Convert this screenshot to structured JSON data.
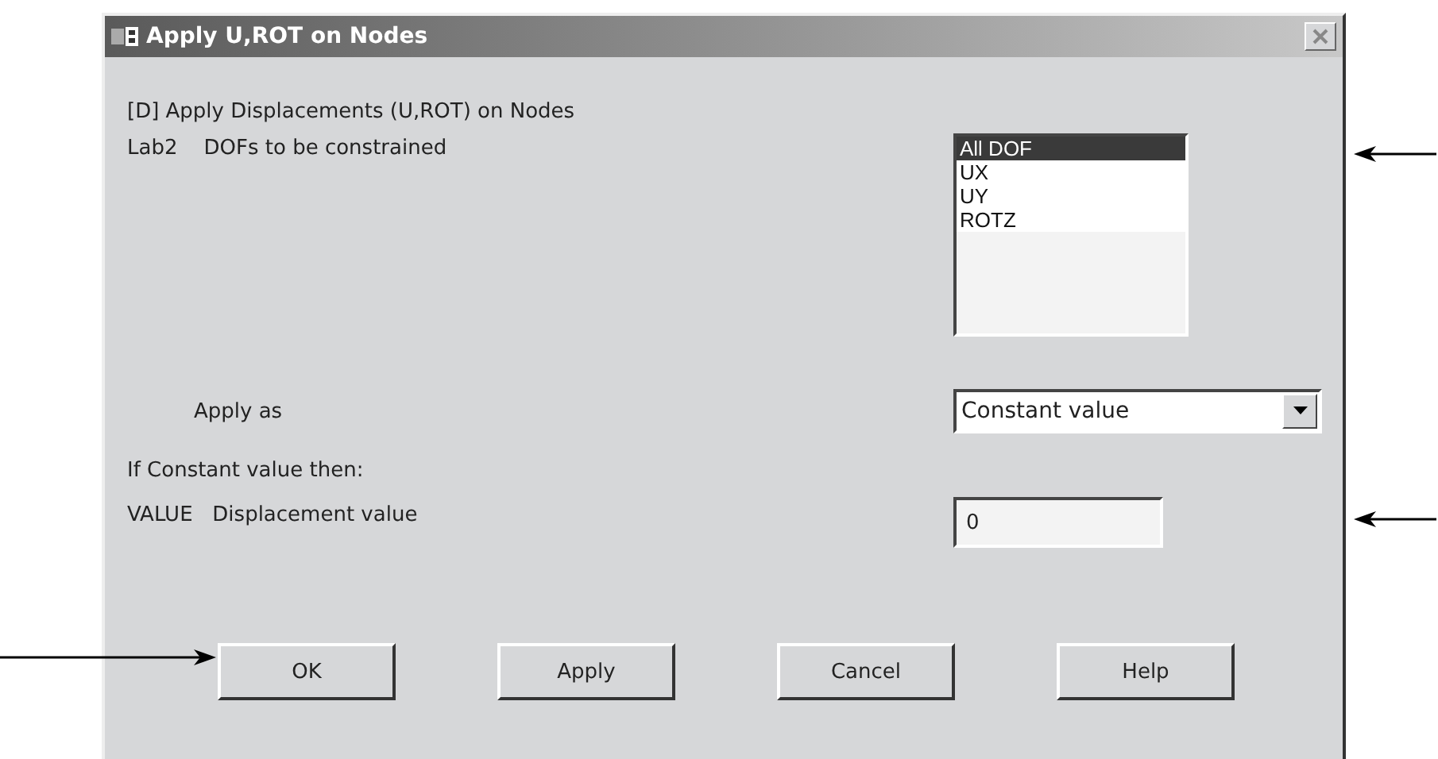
{
  "window": {
    "title": "Apply U,ROT on Nodes"
  },
  "heading": "[D]  Apply Displacements (U,ROT) on Nodes",
  "dof_field": {
    "label": "Lab2    DOFs to be constrained",
    "options": [
      {
        "label": "All DOF",
        "selected": true
      },
      {
        "label": "UX",
        "selected": false
      },
      {
        "label": "UY",
        "selected": false
      },
      {
        "label": "ROTZ",
        "selected": false
      }
    ]
  },
  "apply_as": {
    "label": "Apply as",
    "value": "Constant value"
  },
  "condition_note": "If Constant value then:",
  "value_field": {
    "label": "VALUE   Displacement value",
    "value": "0"
  },
  "buttons": [
    "OK",
    "Apply",
    "Cancel",
    "Help"
  ]
}
